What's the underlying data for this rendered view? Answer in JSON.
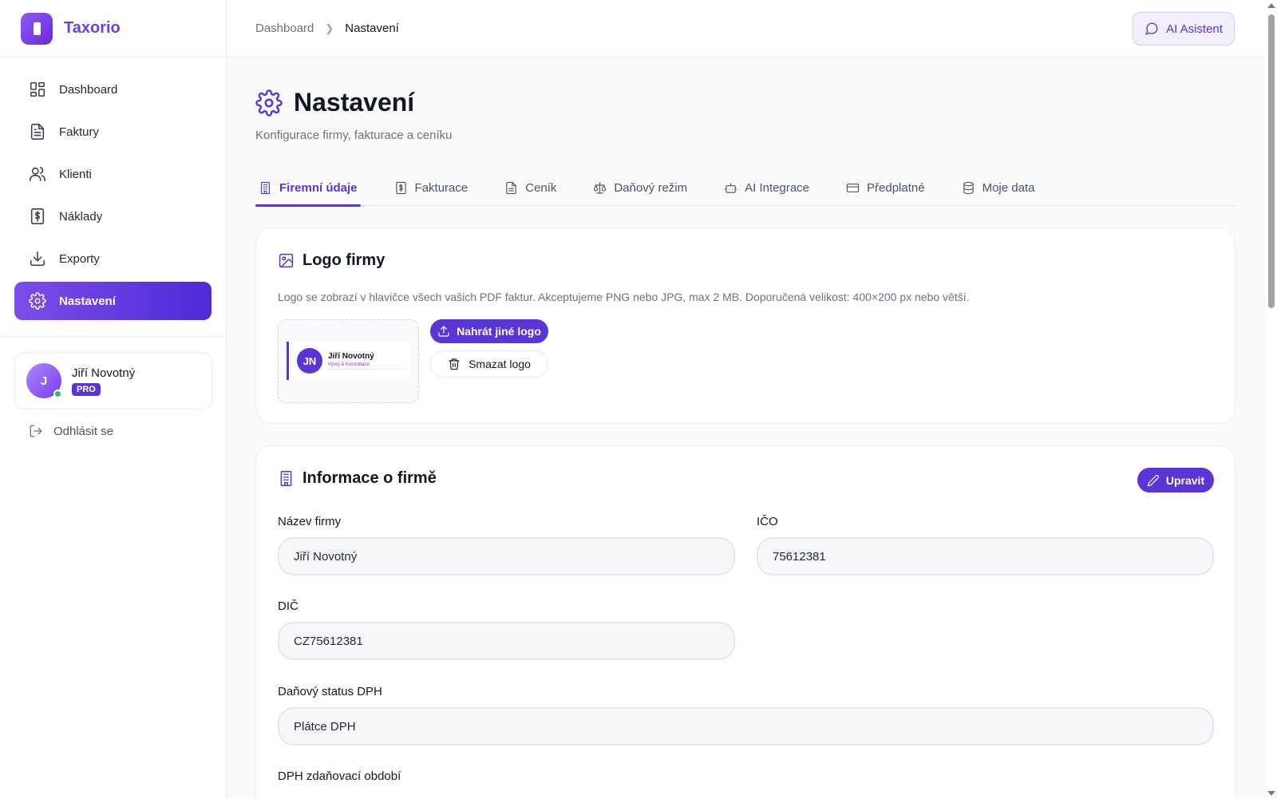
{
  "app": {
    "name": "Taxorio"
  },
  "sidebar": {
    "items": [
      {
        "label": "Dashboard",
        "icon": "dashboard-icon"
      },
      {
        "label": "Faktury",
        "icon": "invoice-icon"
      },
      {
        "label": "Klienti",
        "icon": "users-icon"
      },
      {
        "label": "Náklady",
        "icon": "receipt-icon"
      },
      {
        "label": "Exporty",
        "icon": "download-icon"
      },
      {
        "label": "Nastavení",
        "icon": "gear-icon",
        "active": true
      }
    ],
    "user": {
      "initial": "J",
      "name": "Jiří Novotný",
      "badge": "PRO"
    },
    "logout_label": "Odhlásit se"
  },
  "topbar": {
    "breadcrumb": [
      "Dashboard",
      "Nastavení"
    ],
    "ai_button_label": "AI Asistent"
  },
  "page": {
    "title": "Nastavení",
    "subtitle": "Konfigurace firmy, fakturace a ceníku"
  },
  "tabs": [
    {
      "label": "Firemní údaje",
      "active": true
    },
    {
      "label": "Fakturace"
    },
    {
      "label": "Ceník"
    },
    {
      "label": "Daňový režim"
    },
    {
      "label": "AI Integrace"
    },
    {
      "label": "Předplatné"
    },
    {
      "label": "Moje data"
    }
  ],
  "logo_card": {
    "title": "Logo firmy",
    "description": "Logo se zobrazí v hlavičce všech vašich PDF faktur. Akceptujeme PNG nebo JPG, max 2 MB. Doporučená velikost: 400×200 px nebo větší.",
    "preview": {
      "monogram": "JN",
      "name": "Jiří Novotný",
      "tagline": "Vývoj & Konzultace"
    },
    "upload_label": "Nahrát jiné logo",
    "delete_label": "Smazat logo"
  },
  "info_card": {
    "title": "Informace o firmě",
    "edit_label": "Upravit",
    "fields": {
      "company_name": {
        "label": "Název firmy",
        "value": "Jiří Novotný"
      },
      "ico": {
        "label": "IČO",
        "value": "75612381"
      },
      "dic": {
        "label": "DIČ",
        "value": "CZ75612381"
      },
      "vat_status": {
        "label": "Daňový status DPH",
        "value": "Plátce DPH"
      },
      "vat_period": {
        "label": "DPH zdaňovací období"
      }
    }
  },
  "colors": {
    "accent": "#5b34d8",
    "accent_light": "#8b5cf6",
    "online": "#22c55e"
  }
}
